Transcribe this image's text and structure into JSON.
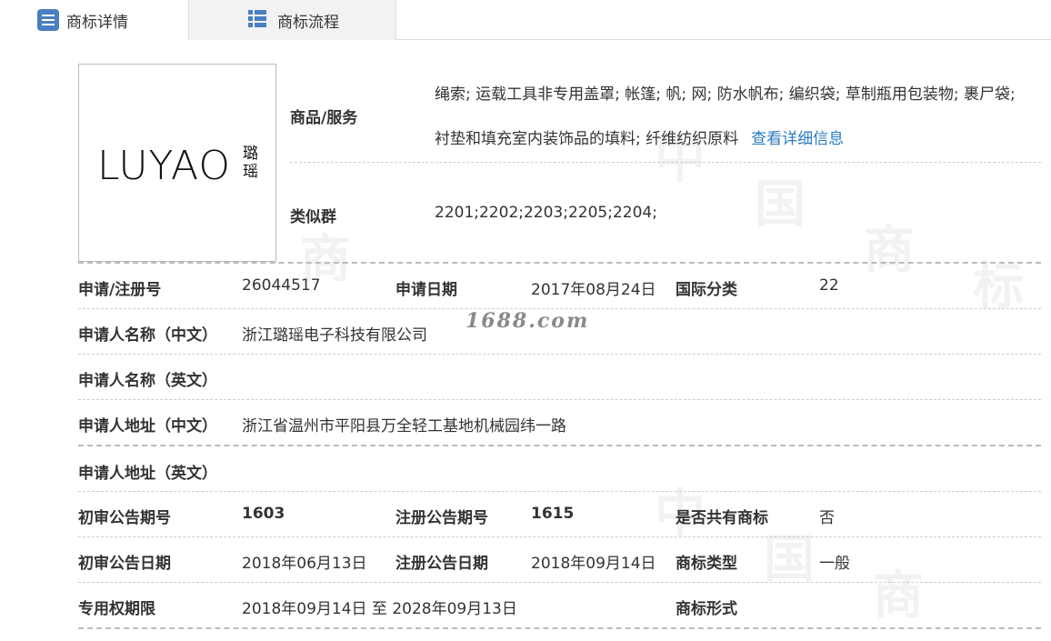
{
  "tabs": {
    "detail": "商标详情",
    "flow": "商标流程"
  },
  "logo": {
    "en": "LUYAO",
    "cn": "璐瑶"
  },
  "watermark_site": "1688.com",
  "goods": {
    "label": "商品/服务",
    "line1": "绳索; 运载工具非专用盖罩; 帐篷; 帆; 网; 防水帆布; 编织袋; 草制瓶用包装物; 裹尸袋;",
    "line2": "衬垫和填充室内装饰品的填料; 纤维纺织原料",
    "link": "查看详细信息"
  },
  "similar": {
    "label": "类似群",
    "value": "2201;2202;2203;2205;2204;"
  },
  "rows": {
    "reg_no_label": "申请/注册号",
    "reg_no": "26044517",
    "apply_date_label": "申请日期",
    "apply_date": "2017年08月24日",
    "intl_class_label": "国际分类",
    "intl_class": "22",
    "name_cn_label": "申请人名称（中文）",
    "name_cn": "浙江璐瑶电子科技有限公司",
    "name_en_label": "申请人名称（英文）",
    "addr_cn_label": "申请人地址（中文）",
    "addr_cn": "浙江省温州市平阳县万全轻工基地机械园纬一路",
    "addr_en_label": "申请人地址（英文）",
    "prelim_no_label": "初审公告期号",
    "prelim_no": "1603",
    "reg_pub_no_label": "注册公告期号",
    "reg_pub_no": "1615",
    "shared_label": "是否共有商标",
    "shared": "否",
    "prelim_date_label": "初审公告日期",
    "prelim_date": "2018年06月13日",
    "reg_pub_date_label": "注册公告日期",
    "reg_pub_date": "2018年09月14日",
    "tm_type_label": "商标类型",
    "tm_type": "一般",
    "term_label": "专用权期限",
    "term": "2018年09月14日 至 2028年09月13日",
    "tm_form_label": "商标形式"
  }
}
